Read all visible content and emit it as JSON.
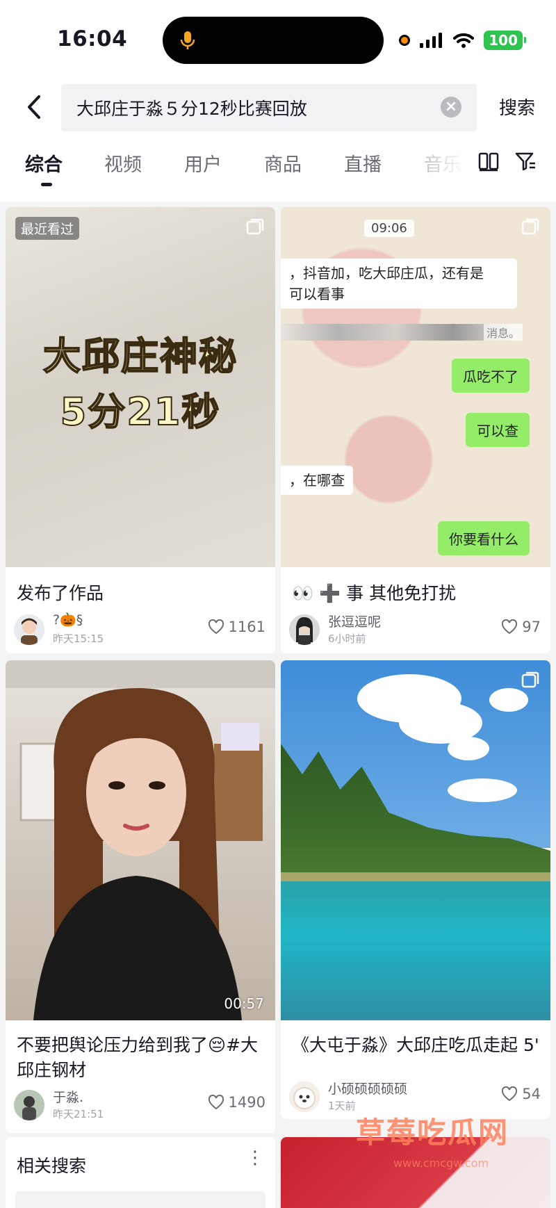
{
  "status_bar": {
    "time": "16:04",
    "battery": "100"
  },
  "search": {
    "query": "大邱庄于淼５分12秒比赛回放",
    "button": "搜索",
    "clear": "×"
  },
  "tabs": [
    {
      "label": "综合",
      "active": true
    },
    {
      "label": "视频"
    },
    {
      "label": "用户"
    },
    {
      "label": "商品"
    },
    {
      "label": "直播"
    },
    {
      "label": "音乐"
    }
  ],
  "cards": [
    {
      "badge": "最近看过",
      "overlay_line1": "大邱庄神秘",
      "overlay_line2": "5分21秒",
      "caption": "发布了作品",
      "author": "?🎃§",
      "time": "昨天15:15",
      "likes": "1161"
    },
    {
      "chat_time": "09:06",
      "msg1_line1": "，抖音加，吃大邱庄瓜，还有是",
      "msg1_line2": "可以看事",
      "sys_msg": "消息。",
      "reply1": "瓜吃不了",
      "reply2": "可以查",
      "msg2": "，在哪查",
      "reply3": "你要看什么",
      "caption": "👀 ➕ 事 其他免打扰",
      "author": "张逗逗呢",
      "time": "6小时前",
      "likes": "97"
    },
    {
      "duration": "00:57",
      "caption": "不要把舆论压力给到我了😔#大邱庄钢材",
      "author": "于淼.",
      "time": "昨天21:51",
      "likes": "1490"
    },
    {
      "caption": "《大屯于淼》大邱庄吃瓜走起 5\"1",
      "author": "小硕硕硕硕硕",
      "time": "1天前",
      "likes": "54"
    }
  ],
  "related": {
    "title": "相关搜索"
  },
  "watermark": {
    "text": "草莓吃瓜网",
    "url": "www.cmcgw.com"
  },
  "colors": {
    "accent": "#161823",
    "chat_green": "#95ec69",
    "battery": "#2fc34f"
  }
}
